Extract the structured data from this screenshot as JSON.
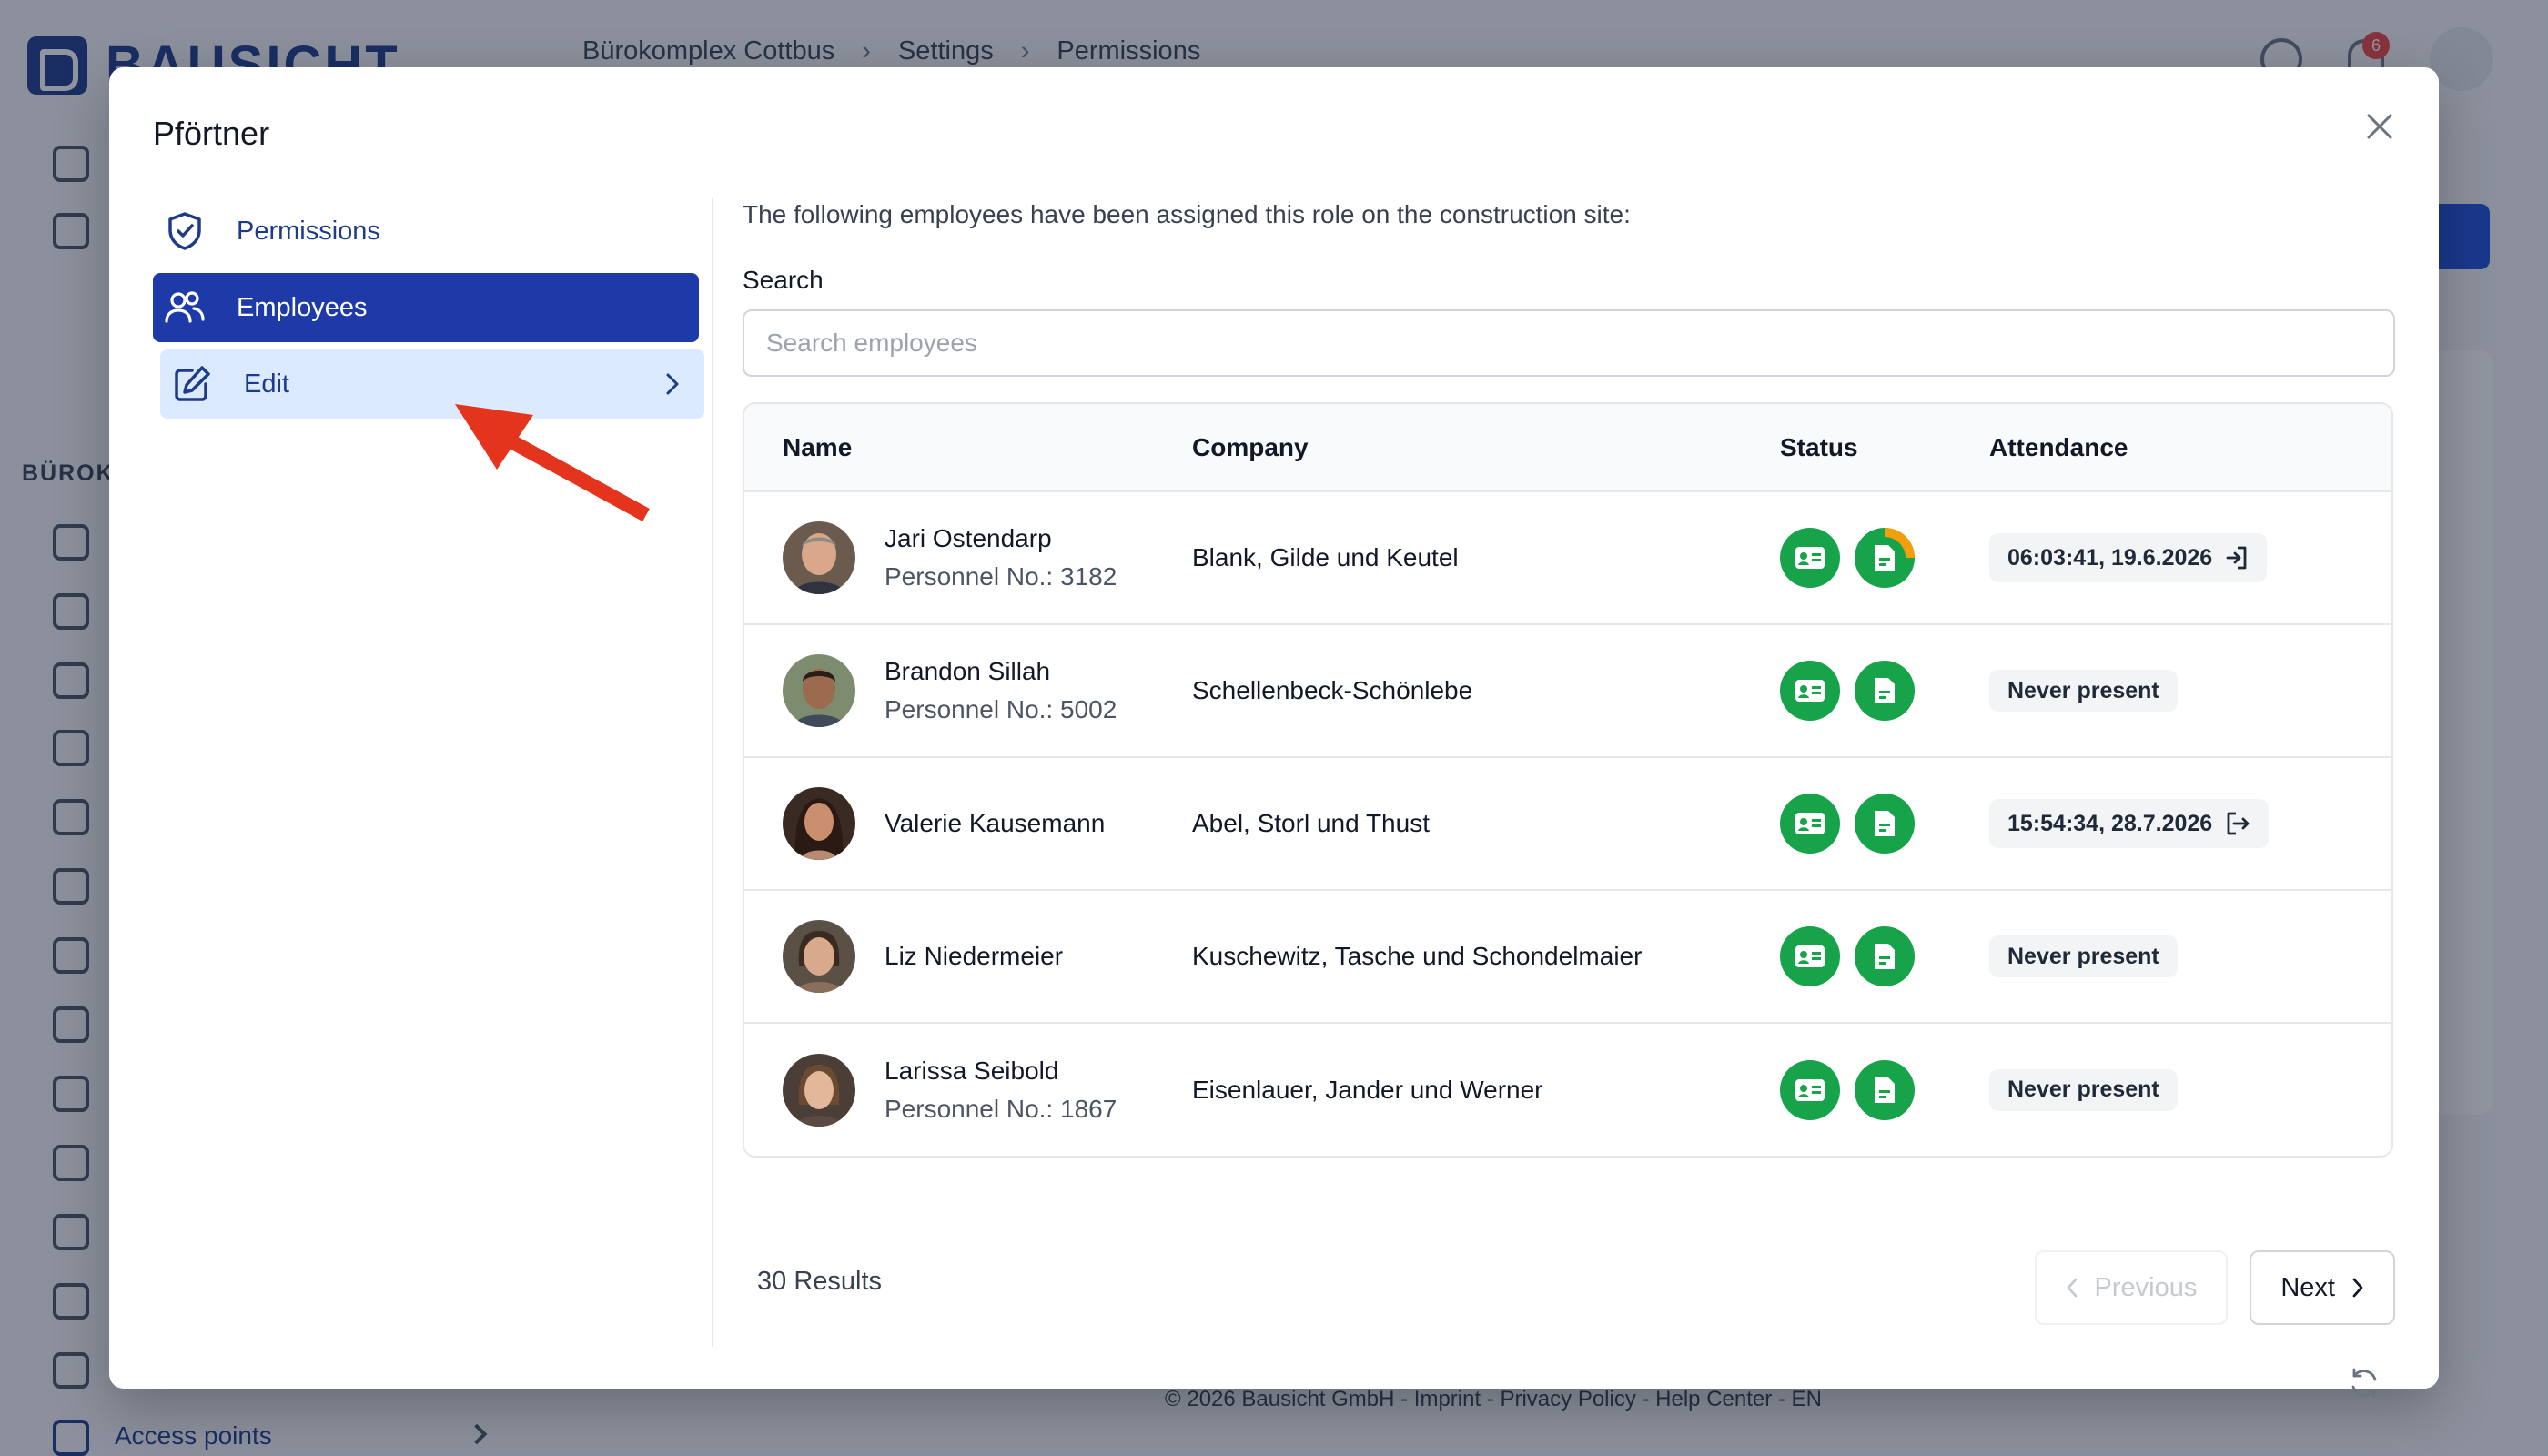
{
  "background": {
    "brand": "BAUSICHT",
    "breadcrumb": [
      "Bürokomplex Cottbus",
      "Settings",
      "Permissions"
    ],
    "notification_count": "6",
    "sidebar_section_label": "BÜROKO",
    "sidebar_bottom_item": "Access points",
    "footer": "© 2026 Bausicht GmbH - Imprint - Privacy Policy - Help Center - EN"
  },
  "modal": {
    "title": "Pförtner",
    "nav": [
      {
        "label": "Permissions",
        "icon": "shield-check-icon"
      },
      {
        "label": "Employees",
        "icon": "users-icon"
      },
      {
        "label": "Edit",
        "icon": "pencil-square-icon"
      }
    ],
    "intro": "The following employees have been assigned this role on the construction site:",
    "search": {
      "label": "Search",
      "placeholder": "Search employees",
      "value": ""
    },
    "table": {
      "headers": [
        "Name",
        "Company",
        "Status",
        "Attendance"
      ],
      "rows": [
        {
          "name": "Jari Ostendarp",
          "personnel": "Personnel No.: 3182",
          "company": "Blank, Gilde und Keutel",
          "attendance": "06:03:41, 19.6.2026",
          "attendance_icon": "sign-in-icon"
        },
        {
          "name": "Brandon Sillah",
          "personnel": "Personnel No.: 5002",
          "company": "Schellenbeck-Schönlebe",
          "attendance": "Never present",
          "attendance_icon": ""
        },
        {
          "name": "Valerie Kausemann",
          "personnel": "",
          "company": "Abel, Storl und Thust",
          "attendance": "15:54:34, 28.7.2026",
          "attendance_icon": "sign-out-icon"
        },
        {
          "name": "Liz Niedermeier",
          "personnel": "",
          "company": "Kuschewitz, Tasche und Schondelmaier",
          "attendance": "Never present",
          "attendance_icon": ""
        },
        {
          "name": "Larissa Seibold",
          "personnel": "Personnel No.: 1867",
          "company": "Eisenlauer, Jander und Werner",
          "attendance": "Never present",
          "attendance_icon": ""
        }
      ]
    },
    "results": "30 Results",
    "pagination": {
      "previous": "Previous",
      "next": "Next"
    }
  },
  "colors": {
    "primary": "#1e3aa8",
    "status_green": "#16a34a",
    "warning_orange": "#f59e0b",
    "arrow_red": "#e5341d"
  }
}
